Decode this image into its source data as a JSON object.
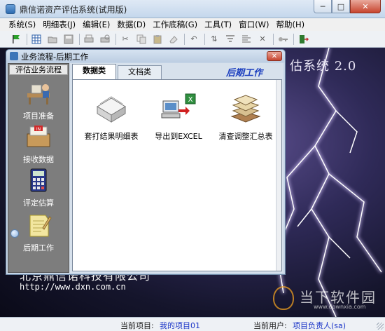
{
  "app": {
    "title": "鼎信诺资产评估系统(试用版)"
  },
  "window_controls": {
    "minimize": "─",
    "maximize": "□",
    "close": "✕"
  },
  "menu": [
    "系统(S)",
    "明细表(J)",
    "编辑(E)",
    "数据(D)",
    "工作底稿(G)",
    "工具(T)",
    "窗口(W)",
    "帮助(H)"
  ],
  "toolbar": {
    "icons": [
      "flag-icon",
      "grid-icon",
      "open-icon",
      "save-icon",
      "print-icon",
      "print-preview-icon",
      "cut-icon",
      "copy-icon",
      "paste-icon",
      "eraser-icon",
      "undo-icon",
      "sort-icon",
      "filter-icon",
      "align-icon",
      "delete-icon",
      "key-icon",
      "exit-icon"
    ]
  },
  "background": {
    "system_title": "估系统 2.0",
    "company": "北京鼎信诺科技有限公司",
    "url": "http://www.dxn.com.cn"
  },
  "watermark": {
    "title": "当下软件园",
    "url": "www.downxia.com"
  },
  "child_window": {
    "title": "业务流程-后期工作",
    "close": "✕",
    "flow_header": "评估业务流程",
    "flow_items": [
      {
        "label": "项目准备",
        "icon": "office-desk-icon"
      },
      {
        "label": "接收数据",
        "icon": "inbox-icon"
      },
      {
        "label": "评定估算",
        "icon": "calculator-icon"
      },
      {
        "label": "后期工作",
        "icon": "notepad-icon"
      }
    ],
    "tabs": [
      "数据类",
      "文档类"
    ],
    "active_tab": "数据类",
    "phase_title": "后期工作",
    "reports": [
      {
        "label": "套打结果明细表",
        "icon": "paper-stack-icon"
      },
      {
        "label": "导出到EXCEL",
        "icon": "export-excel-icon"
      },
      {
        "label": "清查调整汇总表",
        "icon": "document-pile-icon"
      }
    ]
  },
  "status": {
    "project_label": "当前项目:",
    "project_value": "我的项目01",
    "user_label": "当前用户:",
    "user_value": "项目负责人(sa)"
  }
}
